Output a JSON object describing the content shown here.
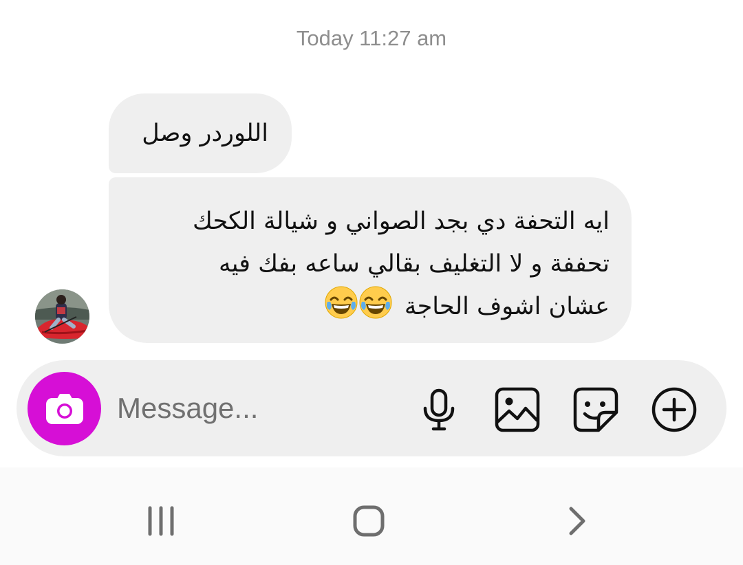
{
  "thread": {
    "timestamp": "Today 11:27 am",
    "messages": [
      {
        "lines": [
          "اللوردر وصل"
        ]
      },
      {
        "lines": [
          "ايه التحفة دي بجد الصواني و شيالة الكحك",
          "تحففة و لا التغليف بقالي ساعه بفك فيه",
          "عشان اشوف الحاجة"
        ],
        "emojis": [
          "face-with-tears-of-joy",
          "face-with-tears-of-joy"
        ]
      }
    ]
  },
  "composer": {
    "placeholder": "Message...",
    "camera_icon": "camera-icon",
    "tools": [
      "microphone-icon",
      "gallery-icon",
      "sticker-icon",
      "plus-icon"
    ],
    "accent_color": "#d60fd6"
  },
  "navbar": {
    "buttons": [
      "recent-apps-icon",
      "home-icon",
      "back-icon"
    ]
  }
}
